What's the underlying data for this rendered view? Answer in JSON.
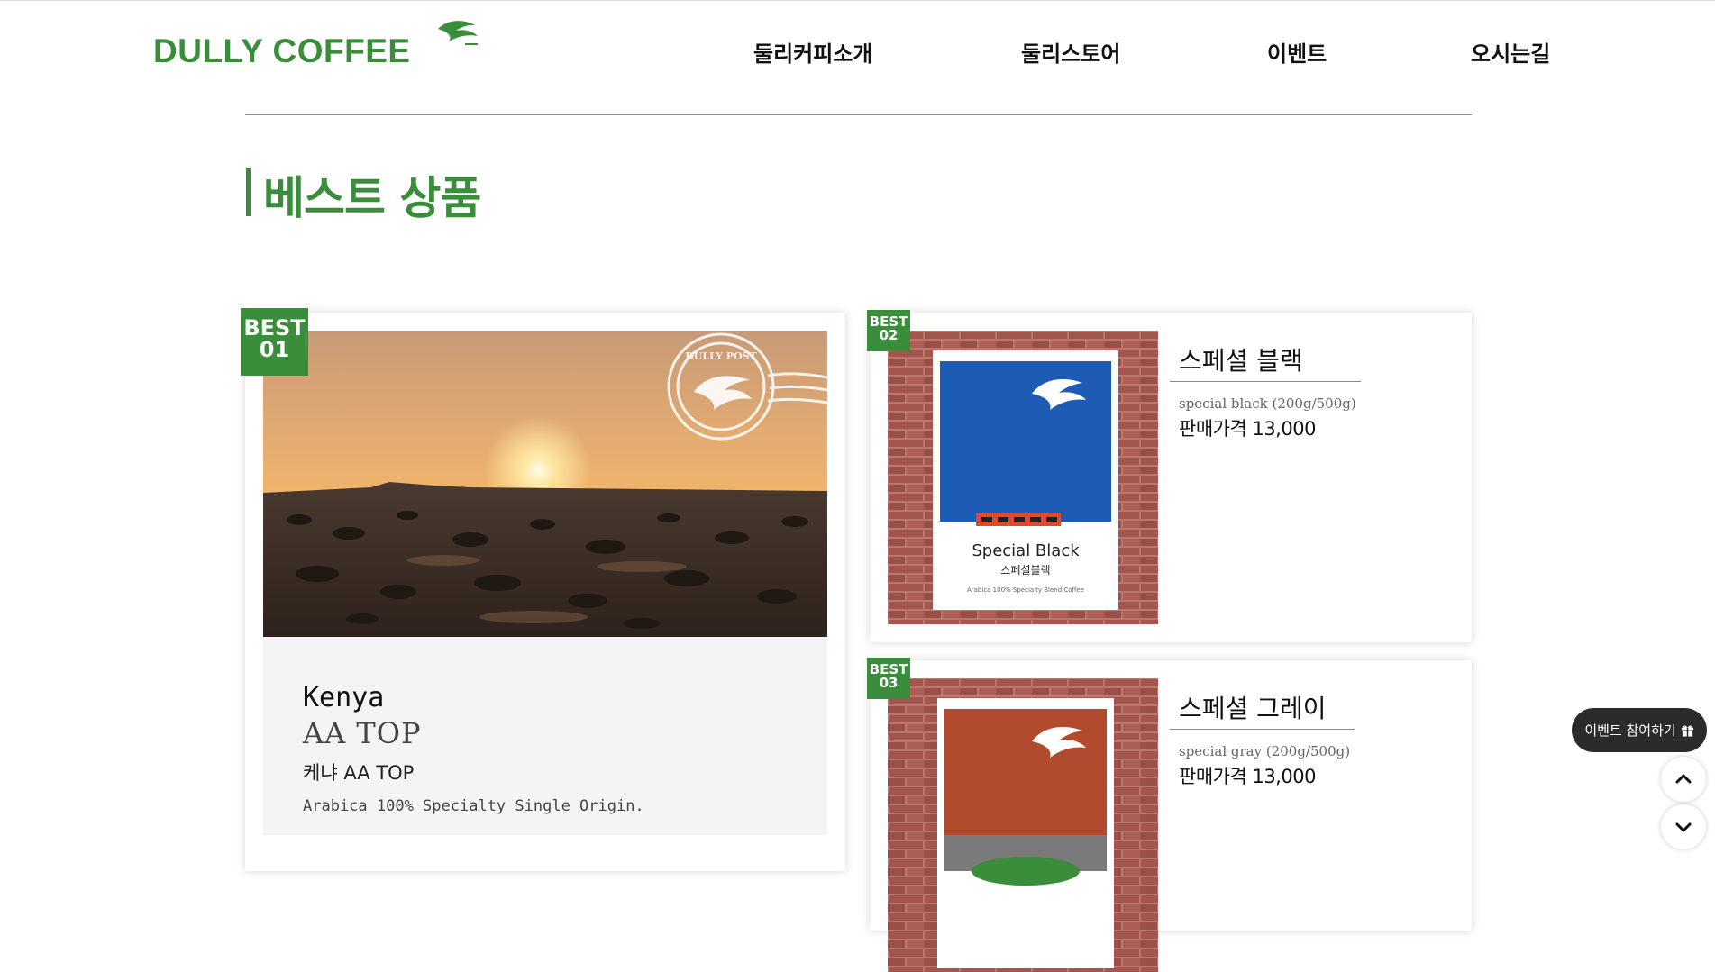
{
  "header": {
    "logo_text": "DULLY COFFEE",
    "nav": [
      "둘리커피소개",
      "둘리스토어",
      "이벤트",
      "오시는길"
    ]
  },
  "section": {
    "title": "베스트 상품"
  },
  "products": [
    {
      "badge_top": "BEST",
      "badge_num": "01",
      "name_en": "Kenya",
      "name_en_sub": "AA TOP",
      "name_ko": "케냐 AA TOP",
      "description": "Arabica 100% Specialty Single Origin.",
      "stamp_text": "DULLY POST"
    },
    {
      "badge_top": "BEST",
      "badge_num": "02",
      "title": "스페셜 블랙",
      "subtitle": "special black (200g/500g)",
      "price": "판매가격 13,000",
      "pack_name_en": "Special Black",
      "pack_name_ko": "스페셜블랙",
      "pack_desc": "Arabica 100% Specialty Blend Coffee",
      "pack_color": "#1e5bb5"
    },
    {
      "badge_top": "BEST",
      "badge_num": "03",
      "title": "스페셜 그레이",
      "subtitle": "special gray (200g/500g)",
      "price": "판매가격 13,000",
      "pack_color": "#b24a2e"
    }
  ],
  "floating": {
    "event_label": "이벤트 참여하기",
    "scroll_up_icon": "chevron-up-icon",
    "scroll_down_icon": "chevron-down-icon"
  },
  "colors": {
    "brand_green": "#3a8d3a",
    "dark": "#2b2b2b"
  }
}
